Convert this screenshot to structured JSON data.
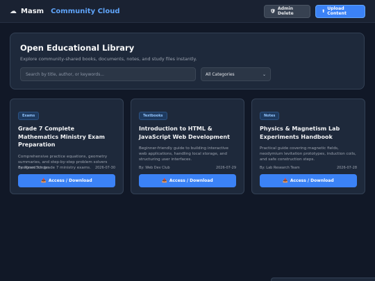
{
  "header": {
    "brand_icon": "cloud-icon",
    "brand_name": "Masm",
    "brand_sub": "Community Cloud",
    "admin_label": "Admin Delete",
    "upload_label": "Upload Content"
  },
  "hero": {
    "title": "Open Educational Library",
    "subtitle": "Explore community-shared books, documents, notes, and study files instantly.",
    "search_placeholder": "Search by title, author, or keywords...",
    "category_selected": "All Categories"
  },
  "cards": [
    {
      "badge": "Exams",
      "title": "Grade 7 Complete Mathematics Ministry Exam Preparation",
      "description": "Comprehensive practice equations, geometry summaries, and step-by-step problem solvers designed for grade 7 ministry exams.",
      "author": "By: Masm Scholar",
      "date": "2026-07-30",
      "button": "Access / Download"
    },
    {
      "badge": "Textbooks",
      "title": "Introduction to HTML & JavaScript Web Development",
      "description": "Beginner-friendly guide to building interactive web applications, handling local storage, and structuring user interfaces.",
      "author": "By: Web Dev Club",
      "date": "2026-07-29",
      "button": "Access / Download"
    },
    {
      "badge": "Notes",
      "title": "Physics & Magnetism Lab Experiments Handbook",
      "description": "Practical guide covering magnetic fields, neodymium levitation prototypes, induction coils, and safe construction steps.",
      "author": "By: Lab Research Team",
      "date": "2026-07-28",
      "button": "Access / Download"
    }
  ],
  "colors": {
    "accent": "#3b82f6",
    "background": "#111827",
    "card": "#1e293b"
  }
}
